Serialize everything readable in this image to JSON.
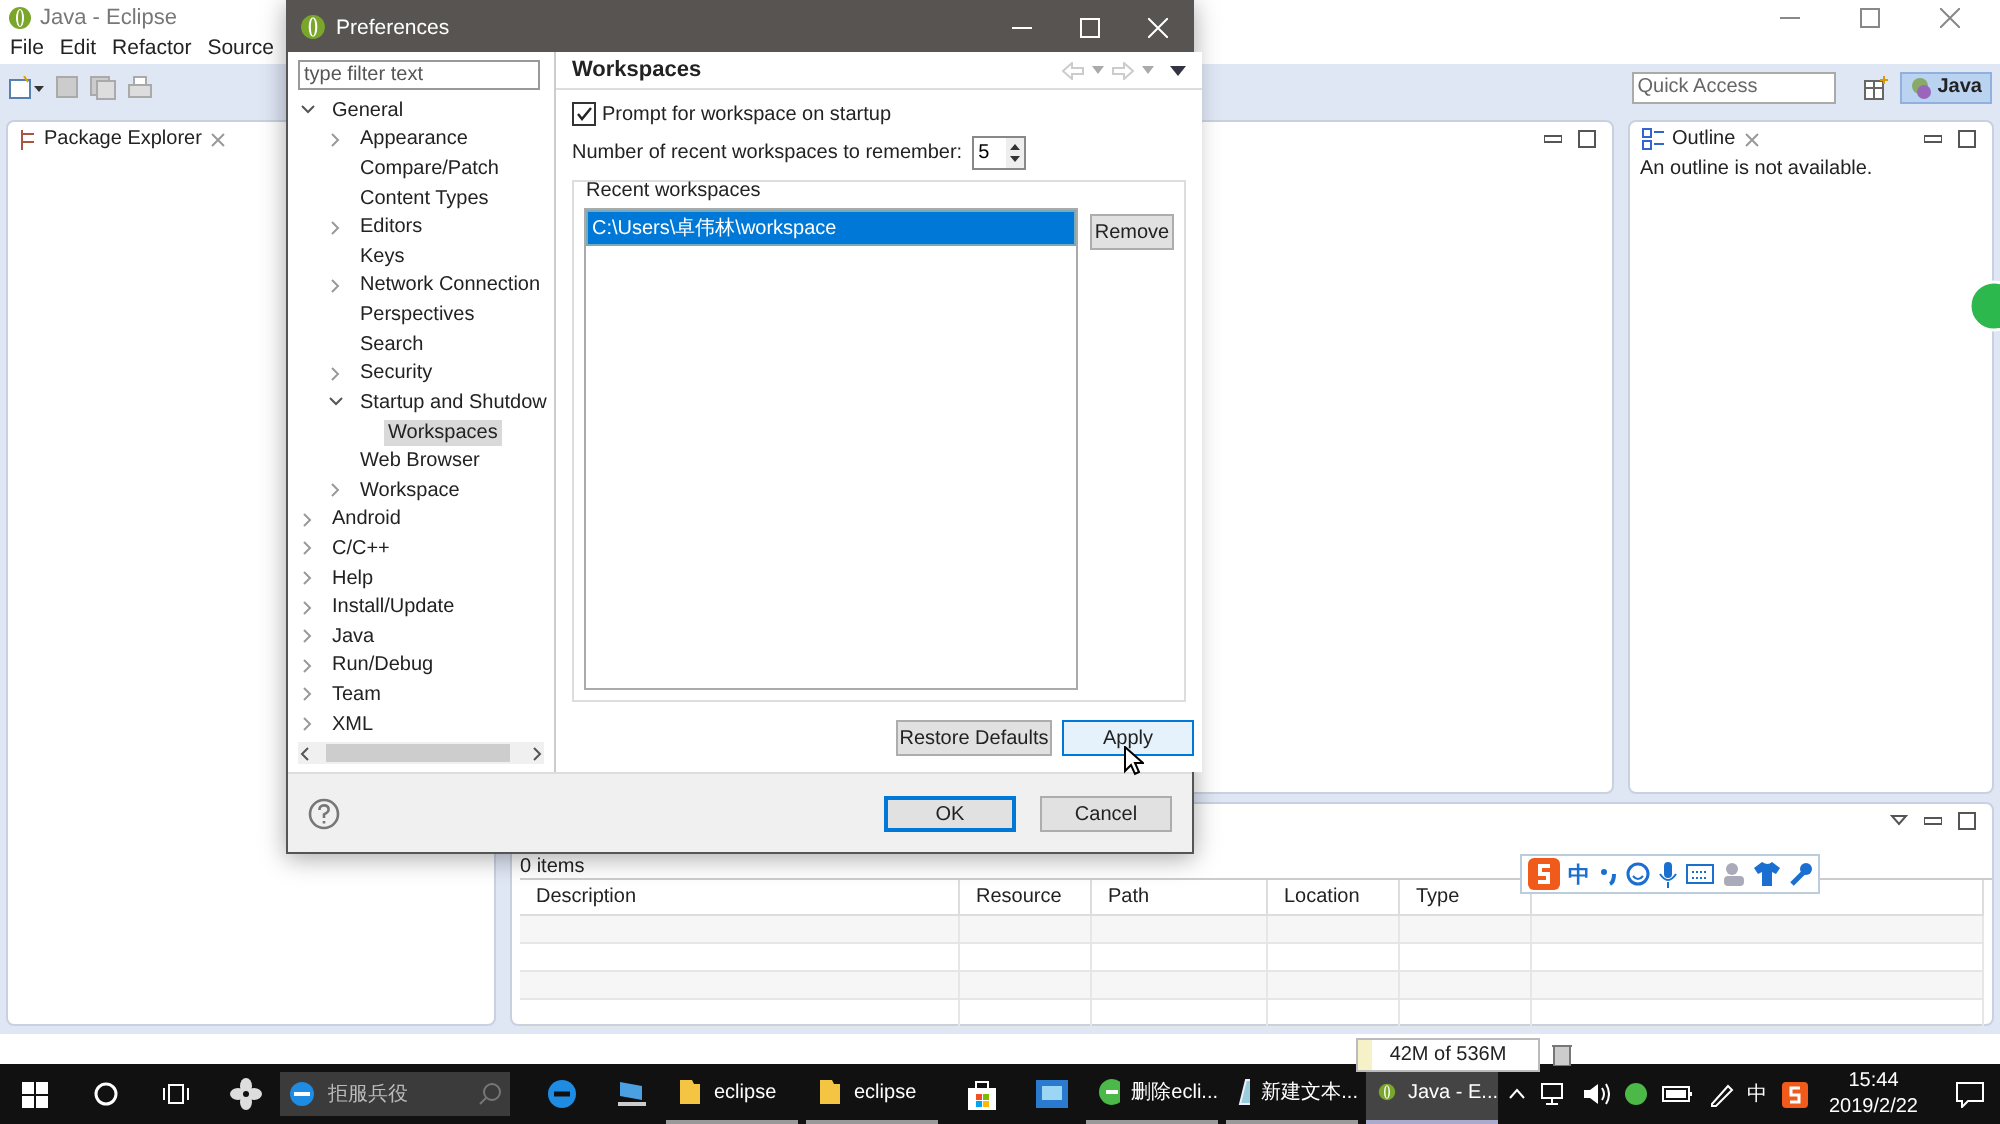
{
  "app": {
    "title": "Java - Eclipse",
    "menu": [
      "File",
      "Edit",
      "Refactor",
      "Source"
    ],
    "quick_access": {
      "placeholder": "Quick Access"
    },
    "perspective": {
      "label": "Java",
      "selected": true
    }
  },
  "package_explorer": {
    "title": "Package Explorer"
  },
  "outline": {
    "title": "Outline",
    "message": "An outline is not available."
  },
  "problems": {
    "count": "0 items",
    "columns": [
      "Description",
      "Resource",
      "Path",
      "Location",
      "Type"
    ]
  },
  "heap": {
    "label": "42M of 536M",
    "level": 0.08
  },
  "ime_bar": {
    "mode": "中"
  },
  "dialog": {
    "title": "Preferences",
    "filter": {
      "placeholder": "type filter text"
    },
    "tree": [
      {
        "label": "General",
        "kind": "expanded",
        "selected": false,
        "children": [
          {
            "label": "Appearance",
            "kind": "collapsed",
            "selected": false
          },
          {
            "label": "Compare/Patch",
            "kind": "leaf",
            "selected": false
          },
          {
            "label": "Content Types",
            "kind": "leaf",
            "selected": false
          },
          {
            "label": "Editors",
            "kind": "collapsed",
            "selected": false
          },
          {
            "label": "Keys",
            "kind": "leaf",
            "selected": false
          },
          {
            "label": "Network Connection",
            "kind": "collapsed",
            "selected": false
          },
          {
            "label": "Perspectives",
            "kind": "leaf",
            "selected": false
          },
          {
            "label": "Search",
            "kind": "leaf",
            "selected": false
          },
          {
            "label": "Security",
            "kind": "collapsed",
            "selected": false
          },
          {
            "label": "Startup and Shutdow",
            "kind": "expanded",
            "selected": false,
            "children": [
              {
                "label": "Workspaces",
                "kind": "leaf",
                "selected": true
              }
            ]
          },
          {
            "label": "Web Browser",
            "kind": "leaf",
            "selected": false
          },
          {
            "label": "Workspace",
            "kind": "collapsed",
            "selected": false
          }
        ]
      },
      {
        "label": "Android",
        "kind": "collapsed",
        "selected": false
      },
      {
        "label": "C/C++",
        "kind": "collapsed",
        "selected": false
      },
      {
        "label": "Help",
        "kind": "collapsed",
        "selected": false
      },
      {
        "label": "Install/Update",
        "kind": "collapsed",
        "selected": false
      },
      {
        "label": "Java",
        "kind": "collapsed",
        "selected": false
      },
      {
        "label": "Run/Debug",
        "kind": "collapsed",
        "selected": false
      },
      {
        "label": "Team",
        "kind": "collapsed",
        "selected": false
      },
      {
        "label": "XML",
        "kind": "collapsed",
        "selected": false
      }
    ],
    "page_title": "Workspaces",
    "prompt": {
      "label": "Prompt for workspace on startup",
      "checked": true
    },
    "recent_count": {
      "label": "Number of recent workspaces to remember:",
      "value": "5"
    },
    "group": "Recent workspaces",
    "workspaces": [
      {
        "path": "C:\\Users\\卓伟林\\workspace",
        "selected": true
      }
    ],
    "remove": "Remove",
    "restore": "Restore Defaults",
    "apply": "Apply",
    "ok": "OK",
    "cancel": "Cancel"
  },
  "taskbar": {
    "search": {
      "placeholder": "拒服兵役"
    },
    "windows": [
      {
        "label": "eclipse",
        "kind": "folder",
        "selected": false
      },
      {
        "label": "eclipse",
        "kind": "folder",
        "selected": false
      },
      {
        "label": "删除ecli...",
        "kind": "app",
        "selected": false
      },
      {
        "label": "新建文本...",
        "kind": "note",
        "selected": false
      },
      {
        "label": "Java - E...",
        "kind": "eclipse",
        "selected": true
      }
    ],
    "ime": "中",
    "time": "15:44",
    "date": "2019/2/22"
  }
}
